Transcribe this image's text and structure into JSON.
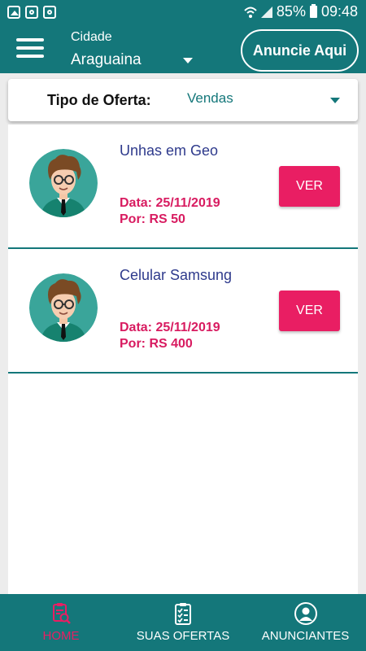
{
  "status_bar": {
    "battery": "85%",
    "time": "09:48"
  },
  "header": {
    "city_label": "Cidade",
    "city_value": "Araguaina",
    "announce_button": "Anuncie Aqui"
  },
  "offer_type": {
    "label": "Tipo de Oferta:",
    "value": "Vendas"
  },
  "offers": [
    {
      "title": "Unhas em Geo",
      "date": "Data: 25/11/2019",
      "price": "Por:  RS 50",
      "button": "VER"
    },
    {
      "title": "Celular Samsung",
      "date": "Data: 25/11/2019",
      "price": "Por:  RS 400",
      "button": "VER"
    }
  ],
  "bottom_nav": {
    "items": [
      {
        "label": "HOME",
        "icon": "search-list-icon",
        "active": true
      },
      {
        "label": "SUAS OFERTAS",
        "icon": "clipboard-icon",
        "active": false
      },
      {
        "label": "ANUNCIANTES",
        "icon": "user-circle-icon",
        "active": false
      }
    ]
  },
  "colors": {
    "primary": "#14777a",
    "accent": "#e91e63",
    "title": "#2e3a8c"
  }
}
